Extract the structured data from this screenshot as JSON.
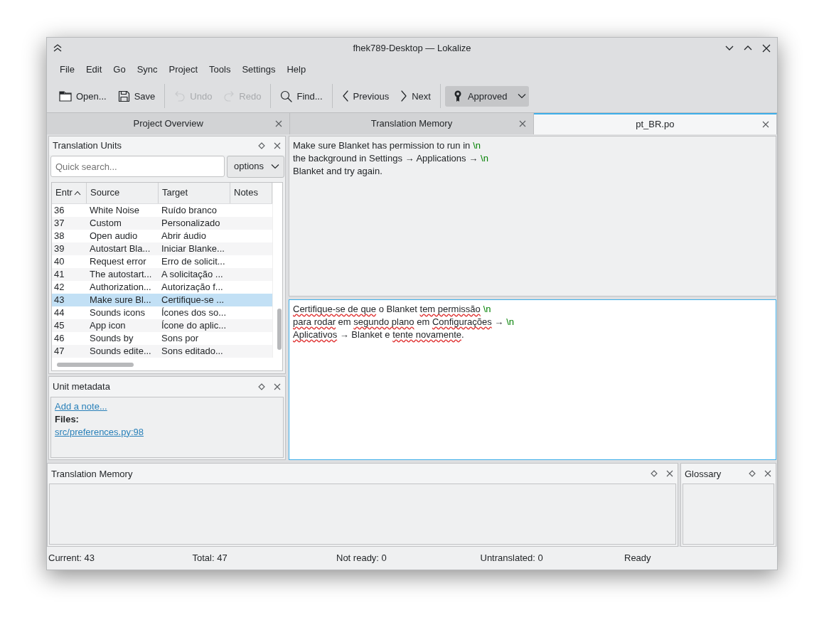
{
  "window": {
    "title": "fhek789-Desktop — Lokalize"
  },
  "menu": [
    "File",
    "Edit",
    "Go",
    "Sync",
    "Project",
    "Tools",
    "Settings",
    "Help"
  ],
  "toolbar": [
    {
      "kind": "open",
      "label": "Open...",
      "disabled": false
    },
    {
      "kind": "save",
      "label": "Save",
      "disabled": false
    },
    {
      "kind": "sep"
    },
    {
      "kind": "undo",
      "label": "Undo",
      "disabled": true
    },
    {
      "kind": "redo",
      "label": "Redo",
      "disabled": true
    },
    {
      "kind": "sep"
    },
    {
      "kind": "find",
      "label": "Find...",
      "disabled": false
    },
    {
      "kind": "sep"
    },
    {
      "kind": "prev",
      "label": "Previous",
      "disabled": false
    },
    {
      "kind": "next",
      "label": "Next",
      "disabled": false
    },
    {
      "kind": "sep"
    },
    {
      "kind": "approved",
      "label": "Approved",
      "disabled": false,
      "checked": true
    }
  ],
  "tabs": [
    {
      "label": "Project Overview",
      "selected": false
    },
    {
      "label": "Translation Memory",
      "selected": false
    },
    {
      "label": "pt_BR.po",
      "selected": true
    }
  ],
  "translation_units": {
    "title": "Translation Units",
    "search": {
      "placeholder": "Quick search..."
    },
    "options": "options",
    "columns": [
      "Entr",
      "Source",
      "Target",
      "Notes"
    ],
    "rows": [
      {
        "entry": "36",
        "source": "White Noise",
        "target": "Ruído branco",
        "selected": false
      },
      {
        "entry": "37",
        "source": "Custom",
        "target": "Personalizado",
        "selected": false
      },
      {
        "entry": "38",
        "source": "Open audio",
        "target": "Abrir áudio",
        "selected": false
      },
      {
        "entry": "39",
        "source": "Autostart Bla...",
        "target": "Iniciar Blanke...",
        "selected": false
      },
      {
        "entry": "40",
        "source": "Request error",
        "target": "Erro de solicit...",
        "selected": false
      },
      {
        "entry": "41",
        "source": "The autostart...",
        "target": "A solicitação ...",
        "selected": false
      },
      {
        "entry": "42",
        "source": "Authorization...",
        "target": "Autorização f...",
        "selected": false
      },
      {
        "entry": "43",
        "source": "Make sure Bl...",
        "target": "Certifique-se ...",
        "selected": true
      },
      {
        "entry": "44",
        "source": "Sounds icons",
        "target": "Ícones dos so...",
        "selected": false
      },
      {
        "entry": "45",
        "source": "App icon",
        "target": "Ícone do aplic...",
        "selected": false
      },
      {
        "entry": "46",
        "source": "Sounds by",
        "target": "Sons por",
        "selected": false
      },
      {
        "entry": "47",
        "source": "Sounds edite...",
        "target": "Sons editado...",
        "selected": false
      }
    ]
  },
  "unit_metadata": {
    "title": "Unit metadata",
    "add_note": "Add a note...",
    "files_label": "Files:",
    "file": "src/preferences.py:98"
  },
  "source_text": [
    {
      "text": "Make sure Blanket has permission to run in",
      "escape": "\\n"
    },
    {
      "text": "the background in Settings → Applications →",
      "escape": "\\n"
    },
    {
      "text": "Blanket and try again."
    }
  ],
  "target_text": [
    {
      "segments": [
        {
          "text": "Certifique-se de que",
          "misspelled": true
        },
        {
          "text": " o Blanket ",
          "misspelled": false
        },
        {
          "text": "tem permissão",
          "misspelled": true
        }
      ],
      "escape": "\\n"
    },
    {
      "segments": [
        {
          "text": "para rodar",
          "misspelled": true
        },
        {
          "text": " em ",
          "misspelled": false
        },
        {
          "text": "segundo plano",
          "misspelled": true
        },
        {
          "text": " em ",
          "misspelled": false
        },
        {
          "text": "Configurações",
          "misspelled": true
        },
        {
          "text": " →",
          "misspelled": false
        }
      ],
      "escape": "\\n"
    },
    {
      "segments": [
        {
          "text": "Aplicativos",
          "misspelled": true
        },
        {
          "text": " → Blanket e ",
          "misspelled": false
        },
        {
          "text": "tente novamente",
          "misspelled": true
        },
        {
          "text": ".",
          "misspelled": false
        }
      ]
    }
  ],
  "translation_memory": {
    "title": "Translation Memory"
  },
  "glossary": {
    "title": "Glossary"
  },
  "status_bar": [
    "Current: 43",
    "Total: 47",
    "Not ready: 0",
    "Untranslated: 0",
    "Ready"
  ]
}
